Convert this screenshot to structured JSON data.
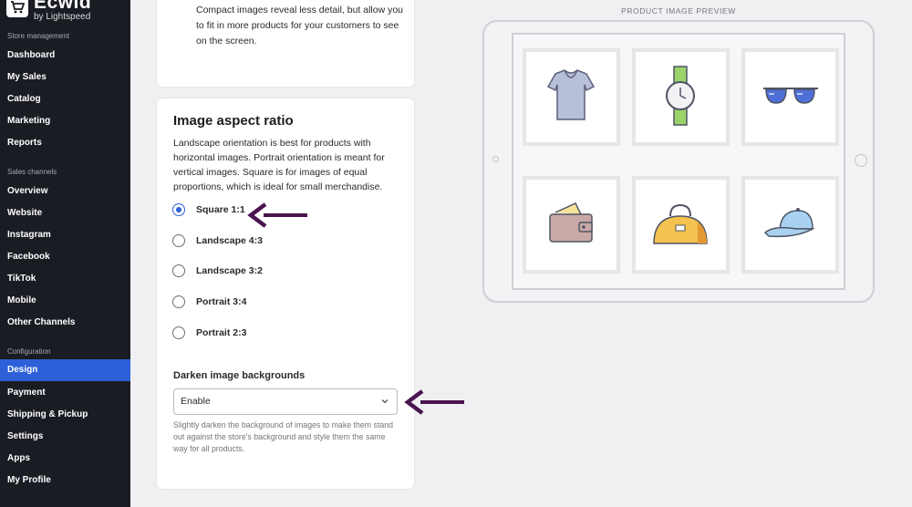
{
  "brand": {
    "name": "Ecwid",
    "sub": "by Lightspeed"
  },
  "sidebar": {
    "sections": [
      {
        "title": "Store management"
      },
      {
        "title": "Sales channels"
      },
      {
        "title": "Configuration"
      }
    ],
    "items": [
      {
        "label": "Dashboard"
      },
      {
        "label": "My Sales"
      },
      {
        "label": "Catalog"
      },
      {
        "label": "Marketing"
      },
      {
        "label": "Reports"
      },
      {
        "label": "Overview"
      },
      {
        "label": "Website"
      },
      {
        "label": "Instagram"
      },
      {
        "label": "Facebook"
      },
      {
        "label": "TikTok"
      },
      {
        "label": "Mobile"
      },
      {
        "label": "Other Channels"
      },
      {
        "label": "Design"
      },
      {
        "label": "Payment"
      },
      {
        "label": "Shipping & Pickup"
      },
      {
        "label": "Settings"
      },
      {
        "label": "Apps"
      },
      {
        "label": "My Profile"
      }
    ],
    "active": "Design"
  },
  "compact_card": {
    "text": "Compact images reveal less detail, but allow you to fit in more products for your customers to see on the screen."
  },
  "aspect": {
    "title": "Image aspect ratio",
    "description": "Landscape orientation is best for products with horizontal images. Portrait orientation is meant for vertical images. Square is for images of equal proportions, which is ideal for small merchandise.",
    "options": [
      {
        "label": "Square 1:1",
        "checked": true
      },
      {
        "label": "Landscape 4:3",
        "checked": false
      },
      {
        "label": "Landscape 3:2",
        "checked": false
      },
      {
        "label": "Portrait 3:4",
        "checked": false
      },
      {
        "label": "Portrait 2:3",
        "checked": false
      }
    ]
  },
  "darken": {
    "label": "Darken image backgrounds",
    "value": "Enable",
    "hint": "Slightly darken the background of images to make them stand out against the store's background and style them the same way for all products."
  },
  "preview": {
    "label": "PRODUCT IMAGE PREVIEW",
    "products": [
      "t-shirt",
      "wristwatch",
      "sunglasses",
      "wallet",
      "handbag",
      "baseball-cap"
    ]
  },
  "colors": {
    "accent": "#2d5fd8",
    "arrow": "#4a1450",
    "sidebar": "#1a1c23"
  }
}
